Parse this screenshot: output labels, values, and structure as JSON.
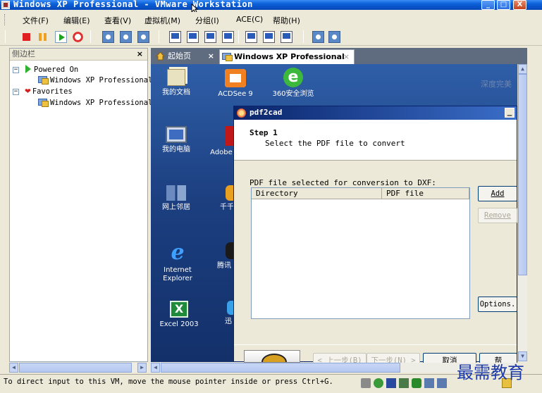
{
  "window": {
    "title": "Windows XP Professional - VMware Workstation",
    "minimize": "_",
    "maximize": "□",
    "close": "X"
  },
  "menu": [
    "文件(F)",
    "编辑(E)",
    "查看(V)",
    "虚拟机(M)",
    "分组(I)",
    "ACE(C)",
    "帮助(H)"
  ],
  "toolbar": {
    "buttons": [
      "power-off-icon",
      "pause-icon",
      "power-on-icon",
      "reset-icon",
      "snapshot-icon",
      "revert-snapshot-icon",
      "snapshot-manager-icon",
      "quick-switch-icon",
      "full-screen-icon",
      "summary-view-icon",
      "console-view-icon",
      "unity-icon",
      "devices-icon",
      "team-icon"
    ]
  },
  "sidebar": {
    "title": "侧边栏",
    "close": "×",
    "tree": [
      {
        "label": "Powered On",
        "expanded": "⊟",
        "icon": "power-on-icon"
      },
      {
        "label": "Windows XP Professional",
        "icon": "vm-icon"
      },
      {
        "label": "Favorites",
        "expanded": "⊟",
        "icon": "favorites-heart-icon"
      },
      {
        "label": "Windows XP Professional",
        "icon": "vm-icon"
      }
    ]
  },
  "tabs": [
    {
      "label": "起始页",
      "close": "×",
      "icon": "home-icon"
    },
    {
      "label": "Windows XP Professional",
      "close": "×",
      "icon": "vm-icon"
    }
  ],
  "desktop": {
    "watermark": "深度完美",
    "icons": [
      {
        "label": "我的文档",
        "icon": "my-documents-icon"
      },
      {
        "label": "ACDSee 9",
        "icon": "acdsee-icon"
      },
      {
        "label": "360安全浏览",
        "icon": "360-browser-icon"
      },
      {
        "label": "我的电脑",
        "icon": "my-computer-icon"
      },
      {
        "label": "Adobe",
        "icon": "adobe-icon"
      },
      {
        "label": "网上邻居",
        "icon": "network-places-icon"
      },
      {
        "label": "千千",
        "icon": "qianqian-icon"
      },
      {
        "label": "Internet Explorer",
        "icon": "internet-explorer-icon"
      },
      {
        "label": "腾讯",
        "icon": "tencent-icon"
      },
      {
        "label": "Excel 2003",
        "icon": "excel-icon"
      },
      {
        "label": "迅",
        "icon": "xunlei-icon"
      }
    ]
  },
  "dialog": {
    "title": "pdf2cad",
    "minimize": "_",
    "step_title": "Step 1",
    "step_desc": "Select the PDF file to convert",
    "list_label": "PDF file selected for conversion to DXF:",
    "columns": [
      "Directory",
      "PDF file"
    ],
    "buttons": {
      "add": "Add",
      "remove": "Remove",
      "options": "Options.",
      "back": "< 上一步(B)",
      "next": "下一步(N) >",
      "cancel": "取消",
      "help": "帮"
    }
  },
  "status": {
    "text": "To direct input to this VM, move the mouse pointer inside or press Ctrl+G.",
    "icons": [
      "hard-disk-icon",
      "cd-rom-icon",
      "floppy-icon",
      "network-icon",
      "usb-icon",
      "sound-icon",
      "printer-icon",
      "display-icon",
      "vmware-tools-icon",
      "message-icon"
    ]
  },
  "corner_watermark": "最需教育",
  "colors": {
    "title_bar": "#0a5fd8",
    "vm_desktop": "#1c3f80",
    "dialog_title": "#0a246a",
    "chrome": "#ece9d8"
  }
}
